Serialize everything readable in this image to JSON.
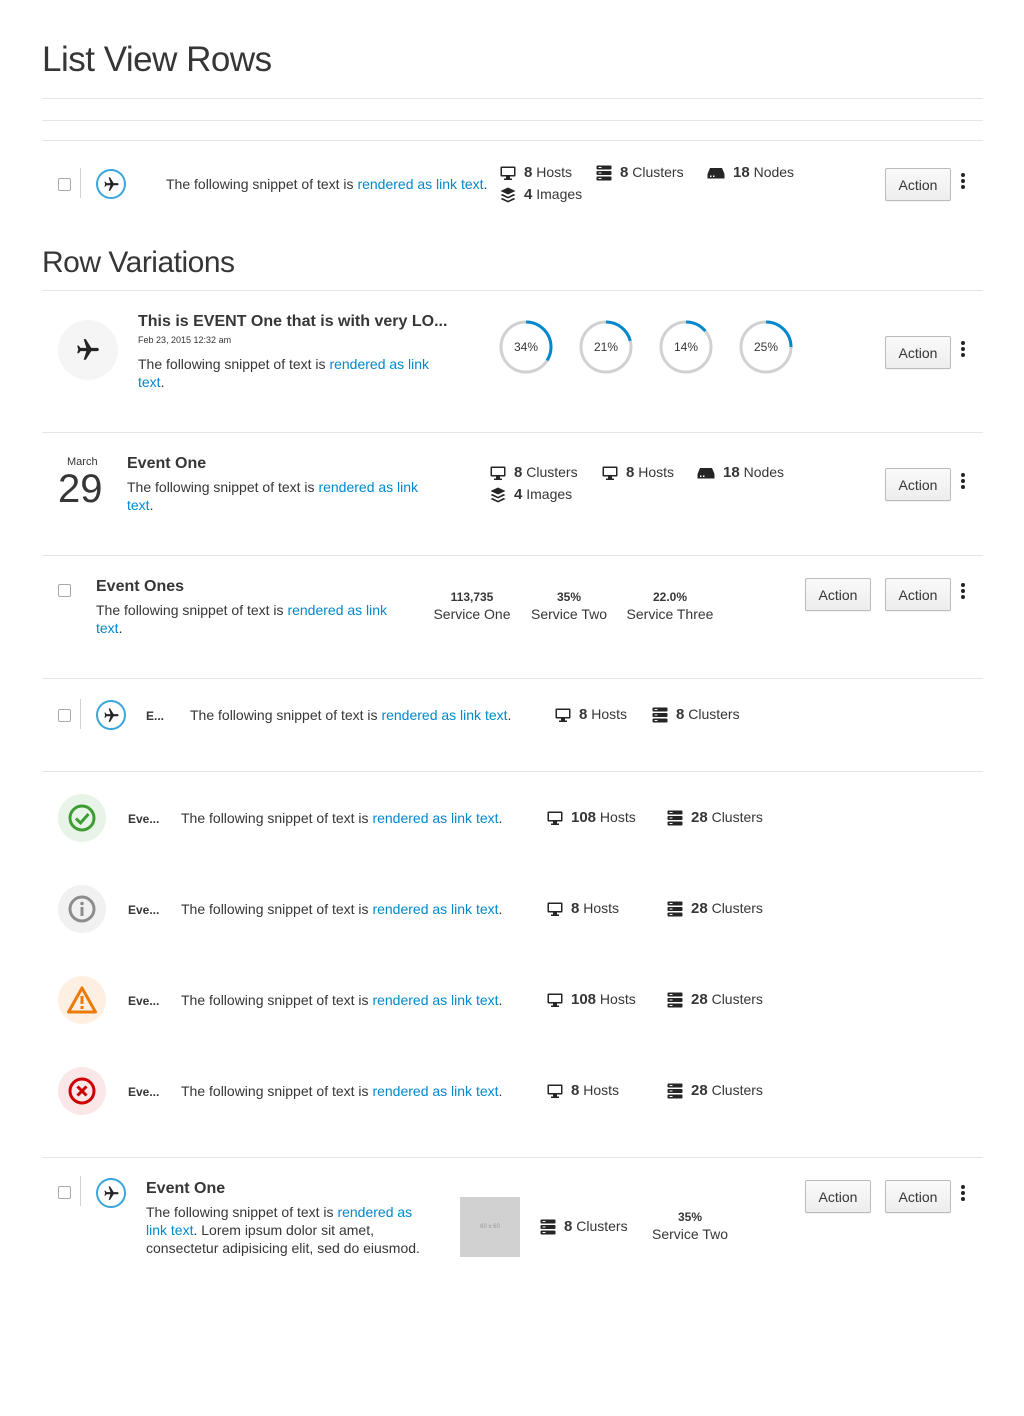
{
  "page": {
    "title": "List View Rows",
    "section_title": "Row Variations"
  },
  "row1": {
    "text_prefix": "The following snippet of text is ",
    "link_text": "rendered as link text",
    "text_suffix": ".",
    "stats": [
      {
        "value": "8",
        "label": "Hosts",
        "icon": "desktop-icon"
      },
      {
        "value": "8",
        "label": "Clusters",
        "icon": "cluster-icon"
      },
      {
        "value": "18",
        "label": "Nodes",
        "icon": "container-node-icon"
      },
      {
        "value": "4",
        "label": "Images",
        "icon": "image-layers-icon"
      }
    ],
    "action_label": "Action"
  },
  "row2": {
    "heading": "This is EVENT One that is with very LO...",
    "timestamp": "Feb 23, 2015 12:32 am",
    "text_prefix": "The following snippet of text is ",
    "link_text_1": "rendered as link",
    "link_text_2": "text",
    "text_suffix": ".",
    "donuts": [
      {
        "label": "34%",
        "value": 34
      },
      {
        "label": "21%",
        "value": 21
      },
      {
        "label": "14%",
        "value": 14
      },
      {
        "label": "25%",
        "value": 25
      }
    ],
    "action_label": "Action",
    "colors": {
      "accent": "#0088ce",
      "track": "#d1d1d1"
    }
  },
  "row3": {
    "month": "March",
    "day": "29",
    "heading": "Event One",
    "text_prefix": "The following snippet of text is ",
    "link_text_1": "rendered as link",
    "link_text_2": "text",
    "text_suffix": ".",
    "stats": [
      {
        "value": "8",
        "label": "Clusters",
        "icon": "desktop-icon"
      },
      {
        "value": "8",
        "label": "Hosts",
        "icon": "desktop-icon"
      },
      {
        "value": "18",
        "label": "Nodes",
        "icon": "container-node-icon"
      },
      {
        "value": "4",
        "label": "Images",
        "icon": "image-layers-icon"
      }
    ],
    "action_label": "Action"
  },
  "row4": {
    "heading": "Event Ones",
    "text_prefix": "The following snippet of text is ",
    "link_text_1": "rendered as link",
    "link_text_2": "text",
    "text_suffix": ".",
    "services": [
      {
        "value": "113,735",
        "label": "Service One"
      },
      {
        "value": "35%",
        "label": "Service Two"
      },
      {
        "value": "22.0%",
        "label": "Service Three"
      }
    ],
    "action_1": "Action",
    "action_2": "Action"
  },
  "row5": {
    "heading": "E...",
    "text_prefix": "The following snippet of text is ",
    "link_text": "rendered as link text",
    "text_suffix": ".",
    "stats": [
      {
        "value": "8",
        "label": "Hosts",
        "icon": "desktop-icon"
      },
      {
        "value": "8",
        "label": "Clusters",
        "icon": "cluster-icon"
      }
    ]
  },
  "status_rows": [
    {
      "status": "ok",
      "icon": "check-circle-icon",
      "heading": "Eve...",
      "text_prefix": "The following snippet of text is ",
      "link_text": "rendered as link text",
      "text_suffix": ".",
      "hosts_value": "108",
      "hosts_label": "Hosts",
      "clusters_value": "28",
      "clusters_label": "Clusters"
    },
    {
      "status": "info",
      "icon": "info-circle-icon",
      "heading": "Eve...",
      "text_prefix": "The following snippet of text is ",
      "link_text": "rendered as link text",
      "text_suffix": ".",
      "hosts_value": "8",
      "hosts_label": "Hosts",
      "clusters_value": "28",
      "clusters_label": "Clusters"
    },
    {
      "status": "warning",
      "icon": "warning-triangle-icon",
      "heading": "Eve...",
      "text_prefix": "The following snippet of text is ",
      "link_text": "rendered as link text",
      "text_suffix": ".",
      "hosts_value": "108",
      "hosts_label": "Hosts",
      "clusters_value": "28",
      "clusters_label": "Clusters"
    },
    {
      "status": "error",
      "icon": "error-circle-icon",
      "heading": "Eve...",
      "text_prefix": "The following snippet of text is ",
      "link_text": "rendered as link text",
      "text_suffix": ".",
      "hosts_value": "8",
      "hosts_label": "Hosts",
      "clusters_value": "28",
      "clusters_label": "Clusters"
    }
  ],
  "row10": {
    "heading": "Event One",
    "text_prefix": "The following snippet of text is ",
    "link_text_1": "rendered as",
    "link_text_2": "link text",
    "text_rest": ". Lorem ipsum dolor sit amet, consectetur adipisicing elit, sed do eiusmod.",
    "thumbnail_label": "60 x 60",
    "clusters_value": "8",
    "clusters_label": "Clusters",
    "service_value": "35%",
    "service_label": "Service Two",
    "action_1": "Action",
    "action_2": "Action"
  },
  "colors": {
    "link": "#0088ce",
    "ok": "#3f9c35",
    "info": "#8b8d8f",
    "warning": "#ec7a08",
    "error": "#cc0000"
  }
}
